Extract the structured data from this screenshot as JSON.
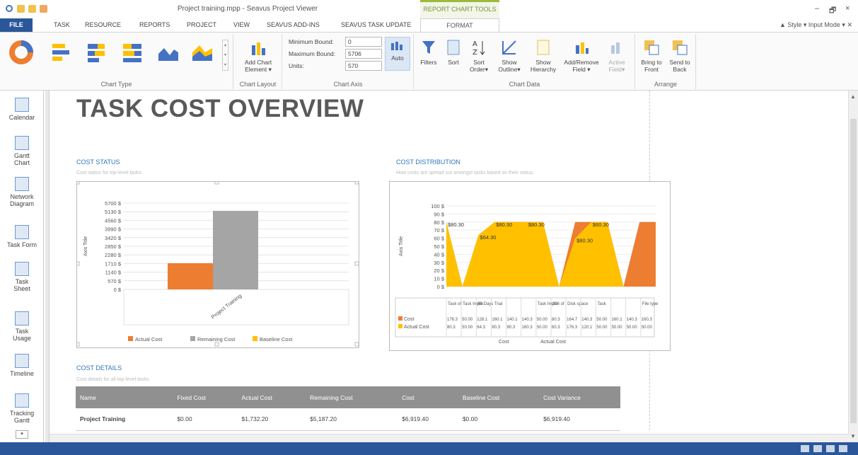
{
  "window": {
    "title": "Project training.mpp - Seavus Project Viewer",
    "context_group": "REPORT CHART TOOLS",
    "minimize": "–",
    "restore": "🗗",
    "close": "×"
  },
  "tabs": [
    "FILE",
    "TASK",
    "RESOURCE",
    "REPORTS",
    "PROJECT",
    "VIEW",
    "SEAVUS ADD-INS",
    "SEAVUS TASK UPDATE",
    "FORMAT"
  ],
  "ribbon_right": "▲ Style ▾ Input Mode ▾ ✕",
  "ribbon": {
    "chart_type_label": "Chart Type",
    "chart_layout": {
      "label": "Chart Layout",
      "add_element": "Add Chart Element ▾"
    },
    "chart_axis": {
      "label": "Chart Axis",
      "min_label": "Minimum Bound:",
      "min_value": "0",
      "max_label": "Maximum Bound:",
      "max_value": "5706",
      "units_label": "Units:",
      "units_value": "570",
      "auto": "Auto"
    },
    "chart_data": {
      "label": "Chart Data",
      "filters": "Filters",
      "sort": "Sort",
      "sort_order": "Sort Order▾",
      "show_outline": "Show Outline▾",
      "show_hierarchy": "Show Hierarchy",
      "add_remove_field": "Add/Remove Field ▾",
      "active_field": "Active Field▾"
    },
    "arrange": {
      "label": "Arrange",
      "bring_front": "Bring to Front",
      "send_back": "Send to Back"
    }
  },
  "sidebar": [
    {
      "label": "Calendar"
    },
    {
      "label": "Gantt Chart"
    },
    {
      "label": "Network Diagram"
    },
    {
      "label": "Task Form"
    },
    {
      "label": "Task Sheet"
    },
    {
      "label": "Task Usage"
    },
    {
      "label": "Timeline"
    },
    {
      "label": "Tracking Gantt"
    }
  ],
  "report": {
    "title": "TASK COST OVERVIEW",
    "cost_status": {
      "heading": "COST STATUS",
      "subtitle": "Cost status for top-level tasks."
    },
    "cost_distribution": {
      "heading": "COST DISTRIBUTION",
      "subtitle": "How costs are spread out amongst tasks based on their status."
    },
    "cost_details": {
      "heading": "COST DETAILS",
      "subtitle": "Cost details for all top-level tasks."
    }
  },
  "chart_data": [
    {
      "type": "bar",
      "ylabel": "Axis Title",
      "categories": [
        "Project Training"
      ],
      "yticks": [
        "5700 $",
        "5130 $",
        "4560 $",
        "3990 $",
        "3420 $",
        "2850 $",
        "2280 $",
        "1710 $",
        "1140 $",
        "570 $",
        "0 $"
      ],
      "ylim": [
        0,
        5700
      ],
      "series": [
        {
          "name": "Actual Cost",
          "values": [
            1732.2
          ],
          "color": "#ed7d31"
        },
        {
          "name": "Remaining Cost",
          "values": [
            5187.2
          ],
          "color": "#a5a5a5"
        },
        {
          "name": "Baseline Cost",
          "values": [
            0
          ],
          "color": "#ffc000"
        }
      ],
      "legend": "bottom"
    },
    {
      "type": "area",
      "ylabel": "Axis Title",
      "yticks": [
        "100 $",
        "90 $",
        "80 $",
        "70 $",
        "60 $",
        "50 $",
        "40 $",
        "30 $",
        "20 $",
        "10 $",
        "0 $"
      ],
      "ylim": [
        0,
        100
      ],
      "data_labels": [
        "$80.30",
        "$64.30",
        "$80.30",
        "$80.30",
        "$80.30",
        "$60.30"
      ],
      "series_names": [
        "Cost",
        "Actual Cost"
      ],
      "cost_values": [
        80,
        0,
        64,
        80,
        80,
        80,
        80,
        0,
        80,
        80,
        80,
        0,
        80,
        80
      ],
      "actual_values": [
        80,
        0,
        64,
        80,
        80,
        80,
        80,
        0,
        60,
        80,
        80,
        0,
        0,
        0
      ],
      "colors": {
        "cost": "#ed7d31",
        "actual": "#ffc000"
      },
      "table_cols": [
        "Task of",
        "Task Imple",
        "60 Days Trial",
        "",
        "",
        "",
        "Task Imple",
        "216 of",
        "Disk space",
        "",
        "Task",
        "",
        "",
        "File type"
      ],
      "cost_row": [
        "176.3",
        "50.00",
        "128.1",
        "160.1",
        "140.1",
        "140.3",
        "50.00",
        "80.3",
        "164.7",
        "140.3",
        "50.00",
        "160.1",
        "140.3",
        "160.3"
      ],
      "actual_row": [
        "80.3",
        "50.00",
        "64.3",
        "80.3",
        "80.3",
        "160.3",
        "50.00",
        "60.3",
        "176.3",
        "120.1",
        "50.00",
        "50.00",
        "50.00",
        "50.00"
      ],
      "axis_labels": [
        "Cost",
        "Actual Cost"
      ]
    }
  ],
  "table": {
    "headers": [
      "Name",
      "Fixed Cost",
      "Actual Cost",
      "Remaining Cost",
      "Cost",
      "Baseline Cost",
      "Cost Variance"
    ],
    "rows": [
      [
        "Project Training",
        "$0.00",
        "$1,732.20",
        "$5,187.20",
        "$6,919.40",
        "$0.00",
        "$6,919.40"
      ]
    ]
  }
}
